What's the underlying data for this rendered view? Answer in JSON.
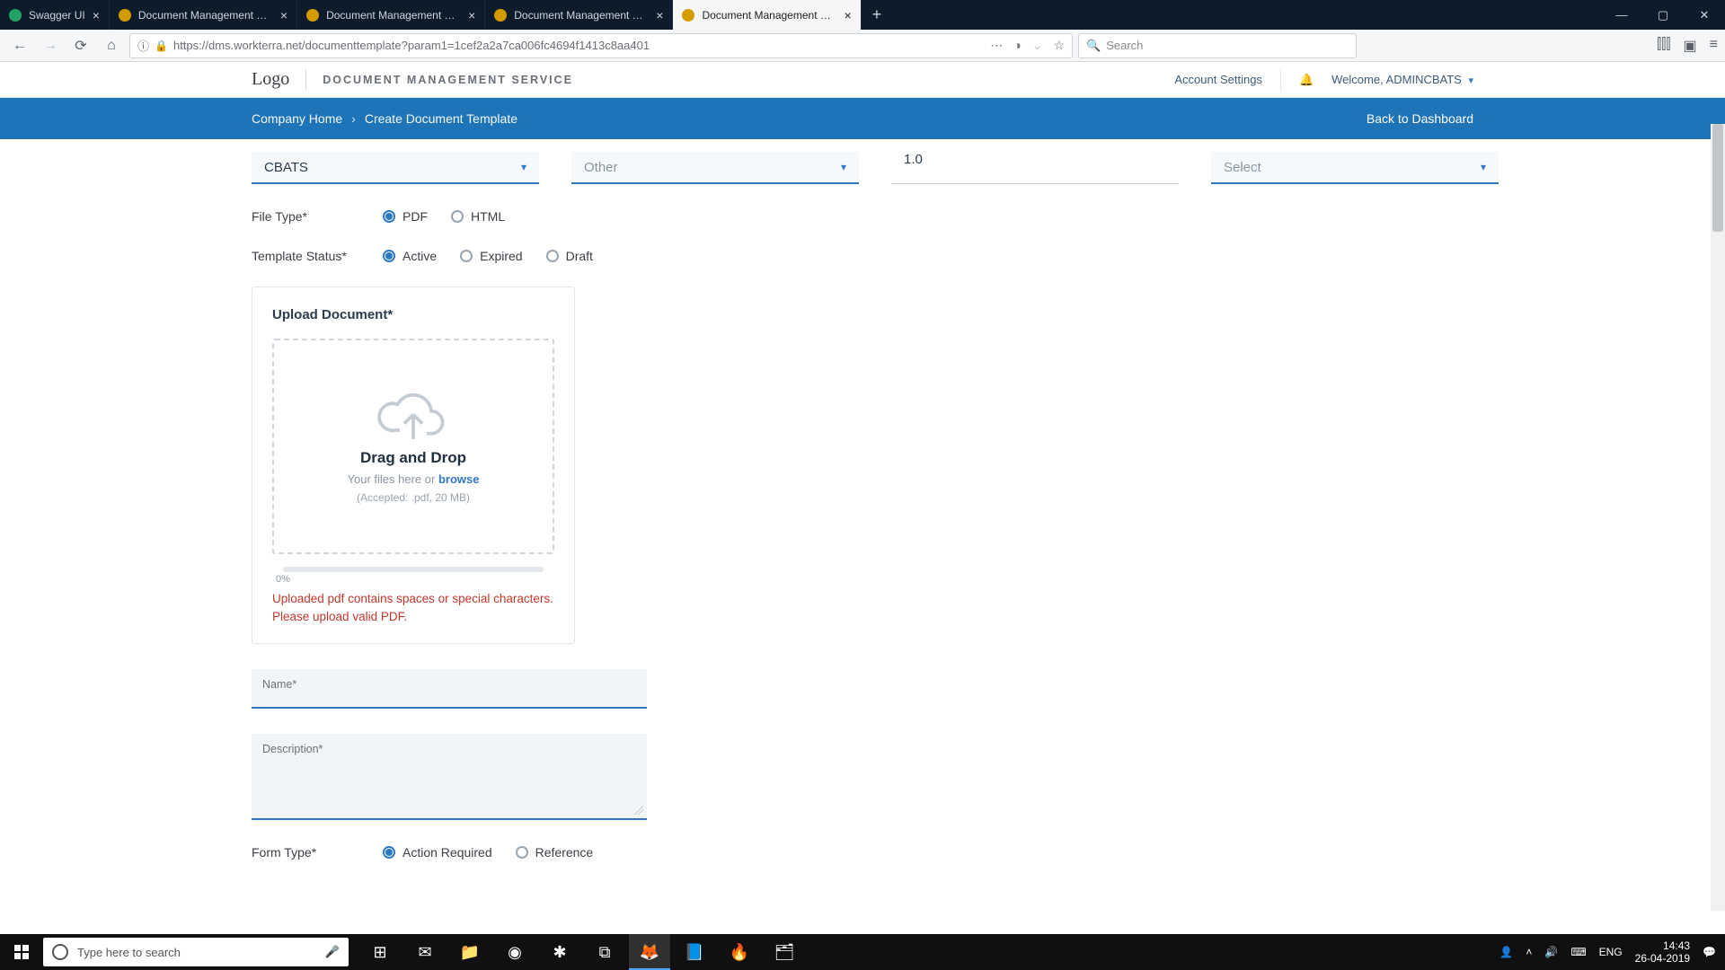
{
  "browser": {
    "tabs": [
      {
        "title": "Swagger UI",
        "active": false
      },
      {
        "title": "Document Management Servic",
        "active": false
      },
      {
        "title": "Document Management Servic",
        "active": false
      },
      {
        "title": "Document Management Servic",
        "active": false
      },
      {
        "title": "Document Management Servic",
        "active": true
      }
    ],
    "url": "https://dms.workterra.net/documenttemplate?param1=1cef2a2a7ca006fc4694f1413c8aa401",
    "search_placeholder": "Search"
  },
  "header": {
    "logo": "Logo",
    "service": "DOCUMENT MANAGEMENT SERVICE",
    "account_settings": "Account Settings",
    "welcome": "Welcome, ADMINCBATS"
  },
  "breadcrumb": {
    "home": "Company Home",
    "current": "Create Document Template",
    "back": "Back to Dashboard"
  },
  "selects": {
    "company": "CBATS",
    "category": "Other",
    "version": "1.0",
    "last": "Select"
  },
  "file_type": {
    "label": "File Type*",
    "options": {
      "pdf": "PDF",
      "html": "HTML"
    }
  },
  "template_status": {
    "label": "Template Status*",
    "options": {
      "active": "Active",
      "expired": "Expired",
      "draft": "Draft"
    }
  },
  "upload": {
    "title": "Upload Document*",
    "dd_title": "Drag and Drop",
    "sub_prefix": "Your files here or ",
    "browse": "browse",
    "note": "(Accepted: .pdf, 20 MB)",
    "pct": "0%",
    "error": "Uploaded pdf contains spaces or special characters. Please upload valid PDF."
  },
  "fields": {
    "name": "Name*",
    "description": "Description*"
  },
  "form_type": {
    "label": "Form Type*",
    "options": {
      "action": "Action Required",
      "reference": "Reference"
    }
  },
  "taskbar": {
    "search_placeholder": "Type here to search",
    "lang": "ENG",
    "time": "14:43",
    "date": "26-04-2019"
  }
}
